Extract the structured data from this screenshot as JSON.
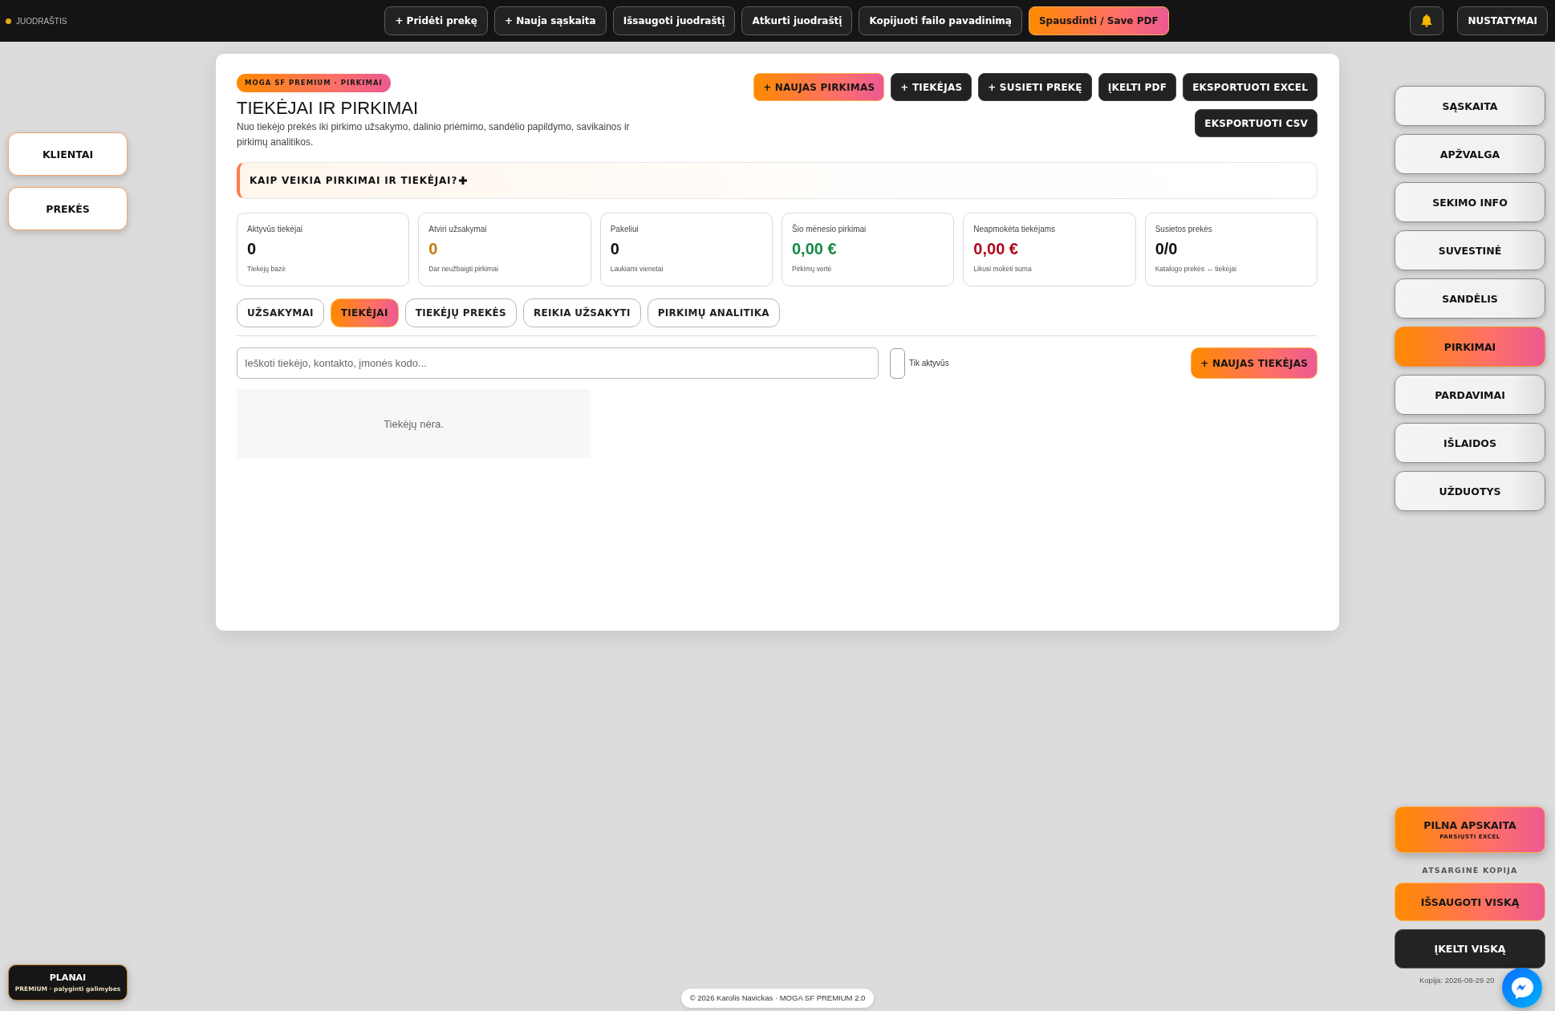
{
  "top_bar": {
    "status": "JUODRAŠTIS",
    "actions": [
      {
        "label": "+ Pridėti prekę",
        "kind": "plain"
      },
      {
        "label": "+ Nauja sąskaita",
        "kind": "plain"
      },
      {
        "label": "Išsaugoti juodraštį",
        "kind": "plain"
      },
      {
        "label": "Atkurti juodraštį",
        "kind": "plain"
      },
      {
        "label": "Kopijuoti failo pavadinimą",
        "kind": "plain"
      },
      {
        "label": "Spausdinti / Save PDF",
        "kind": "primary"
      }
    ],
    "settings": "NUSTATYMAI"
  },
  "left_nav": [
    {
      "label": "KLIENTAI",
      "selected": false
    },
    {
      "label": "PREKĖS",
      "selected": false
    }
  ],
  "panel": {
    "badge": "MOGA SF PREMIUM · PIRKIMAI",
    "title": "TIEKĖJAI IR PIRKIMAI",
    "description": "Nuo tiekėjo prekės iki pirkimo užsakymo, dalinio priėmimo, sandėlio papildymo, savikainos ir pirkimų analitikos.",
    "actions": [
      {
        "label": "+ NAUJAS PIRKIMAS",
        "kind": "primary"
      },
      {
        "label": "+ TIEKĖJAS",
        "kind": "dark"
      },
      {
        "label": "+ SUSIETI PREKĘ",
        "kind": "dark"
      },
      {
        "label": "ĮKELTI PDF",
        "kind": "dark"
      },
      {
        "label": "EKSPORTUOTI EXCEL",
        "kind": "dark"
      },
      {
        "label": "EKSPORTUOTI CSV",
        "kind": "dark"
      }
    ],
    "help": {
      "title": "KAIP VEIKIA PIRKIMAI IR TIEKĖJAI?",
      "expanded": false
    },
    "stats": [
      {
        "label": "Aktyvūs tiekėjai",
        "value": "0",
        "note": "Tiekėjų bazė",
        "color": "#111111"
      },
      {
        "label": "Atviri užsakymai",
        "value": "0",
        "note": "Dar neužbaigti pirkimai",
        "color": "#c47a0a"
      },
      {
        "label": "Pakeliui",
        "value": "0",
        "note": "Laukiami vienetai",
        "color": "#111111"
      },
      {
        "label": "Šio mėnesio pirkimai",
        "value": "0,00 €",
        "note": "Pirkimų vertė",
        "color": "#178a45"
      },
      {
        "label": "Neapmokėta tiekėjams",
        "value": "0,00 €",
        "note": "Likusi mokėti suma",
        "color": "#b3061c"
      },
      {
        "label": "Susietos prekės",
        "value": "0/0",
        "note": "Katalogo prekės ↔ tiekėjai",
        "color": "#111111"
      }
    ],
    "tabs": [
      {
        "label": "UŽSAKYMAI",
        "selected": false
      },
      {
        "label": "TIEKĖJAI",
        "selected": true
      },
      {
        "label": "TIEKĖJŲ PREKĖS",
        "selected": false
      },
      {
        "label": "REIKIA UŽSAKYTI",
        "selected": false
      },
      {
        "label": "PIRKIMŲ ANALITIKA",
        "selected": false
      }
    ],
    "search": {
      "placeholder": "Ieškoti tiekėjo, kontakto, įmonės kodo..."
    },
    "filter": {
      "label": "Tik aktyvūs",
      "checked": false
    },
    "add_button": "+ NAUJAS TIEKĖJAS",
    "empty_message": "Tiekėjų nėra."
  },
  "right_nav": [
    {
      "label": "SĄSKAITA",
      "selected": false
    },
    {
      "label": "APŽVALGA",
      "selected": false
    },
    {
      "label": "SEKIMO INFO",
      "selected": false
    },
    {
      "label": "SUVESTINĖ",
      "selected": false
    },
    {
      "label": "SANDĖLIS",
      "selected": false
    },
    {
      "label": "PIRKIMAI",
      "selected": true
    },
    {
      "label": "PARDAVIMAI",
      "selected": false
    },
    {
      "label": "IŠLAIDOS",
      "selected": false
    },
    {
      "label": "UŽDUOTYS",
      "selected": false
    }
  ],
  "full_accounting": {
    "label": "PILNA APSKAITA",
    "sublabel": "PARSIŲSTI EXCEL"
  },
  "backup": {
    "heading": "ATSARGINĖ KOPIJA",
    "save": "IŠSAUGOTI VISKĄ",
    "load": "ĮKELTI VISKĄ",
    "last_copy": "Kopija: 2026-08-29 20"
  },
  "plans": {
    "label": "PLANAI",
    "sublabel": "PREMIUM · palyginti galimybes"
  },
  "footer": "© 2026 Karolis Navickas · MOGA SF PREMIUM 2.0"
}
